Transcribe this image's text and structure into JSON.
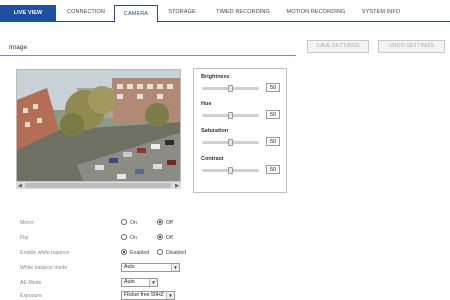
{
  "nav": {
    "tabs": [
      {
        "label": "LIVE VIEW"
      },
      {
        "label": "CONNECTION"
      },
      {
        "label": "CAMERA"
      },
      {
        "label": "STORAGE"
      },
      {
        "label": "TIMED RECORDING"
      },
      {
        "label": "MOTION RECORDING"
      },
      {
        "label": "SYSTEM INFO"
      }
    ]
  },
  "section": {
    "title": "Image"
  },
  "buttons": {
    "save": "SAVE SETTINGS",
    "undo": "UNDO SETTINGS"
  },
  "sliders": [
    {
      "label": "Brightness",
      "value": "50",
      "level": 0.5
    },
    {
      "label": "Hue",
      "value": "50",
      "level": 0.5
    },
    {
      "label": "Saturation",
      "value": "50",
      "level": 0.5
    },
    {
      "label": "Contrast",
      "value": "50",
      "level": 0.5
    }
  ],
  "settings": {
    "mirror": {
      "label": "Mirror:",
      "opt1": "On",
      "opt2": "Off",
      "selected": "Off"
    },
    "flip": {
      "label": "Flip:",
      "opt1": "On",
      "opt2": "Off",
      "selected": "Off"
    },
    "enable_wb": {
      "label": "Enable white balance",
      "opt1": "Enabled",
      "opt2": "Disabled",
      "selected": "Enabled"
    },
    "wb_mode": {
      "label": "White balance mode",
      "value": "Auto"
    },
    "ae_mode": {
      "label": "AE Mode",
      "value": "Auto"
    },
    "exposure": {
      "label": "Exposure",
      "value": "Flicker free 50HZ"
    }
  },
  "colors": {
    "accent": "#1f4fa0",
    "rule": "#6f8fc8"
  }
}
